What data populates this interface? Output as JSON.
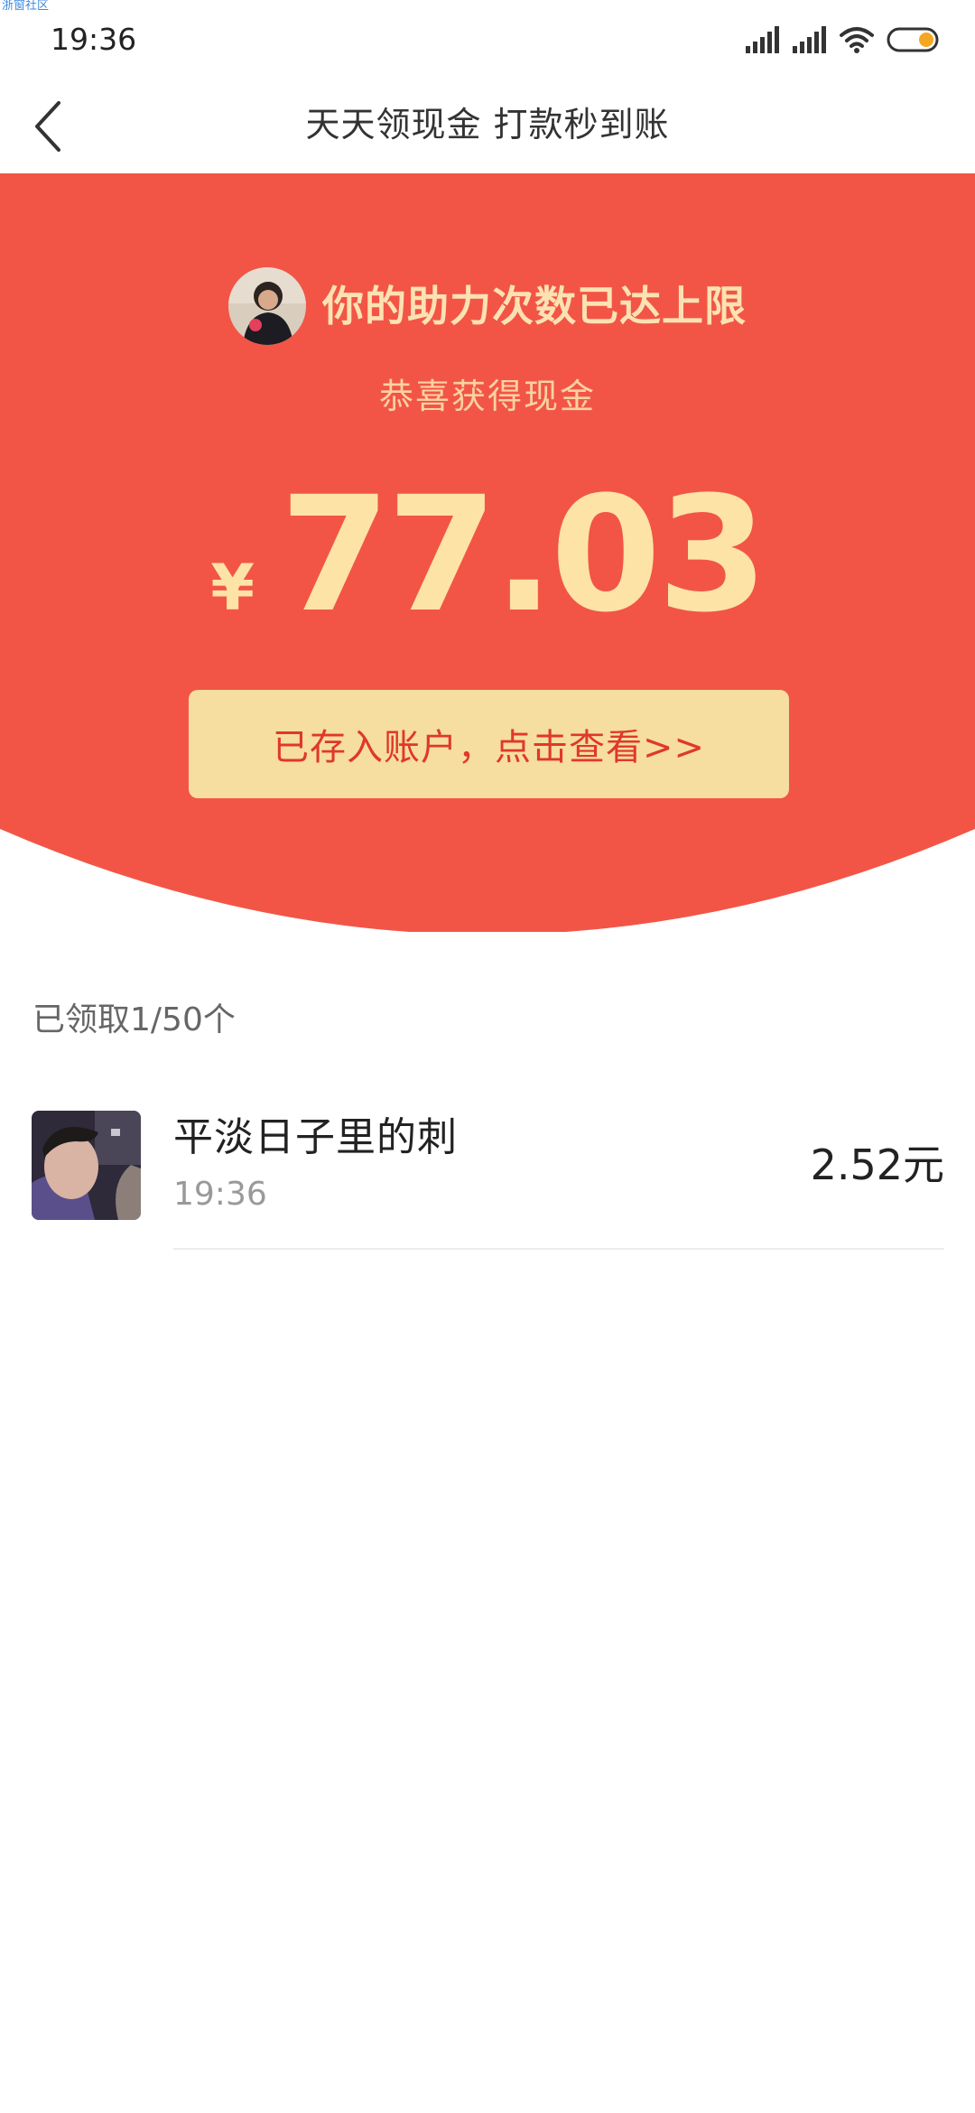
{
  "watermark": "浙窗社区",
  "status_bar": {
    "time": "19:36",
    "icons": [
      "signal-icon",
      "signal-icon",
      "wifi-icon",
      "battery-icon"
    ]
  },
  "header": {
    "title": "天天领现金 打款秒到账",
    "back_icon": "chevron-left-icon"
  },
  "banner": {
    "status_text": "你的助力次数已达上限",
    "congrats_text": "恭喜获得现金",
    "currency_symbol": "¥",
    "amount": "77.03",
    "button_label": "已存入账户，点击查看>>",
    "colors": {
      "background": "#f25546",
      "button": "#f5de9f",
      "button_text": "#e0382b",
      "amount": "#fde3a6"
    }
  },
  "claims": {
    "count_label": "已领取1/50个",
    "items": [
      {
        "name": "平淡日子里的刺",
        "time": "19:36",
        "amount": "2.52元"
      }
    ]
  }
}
